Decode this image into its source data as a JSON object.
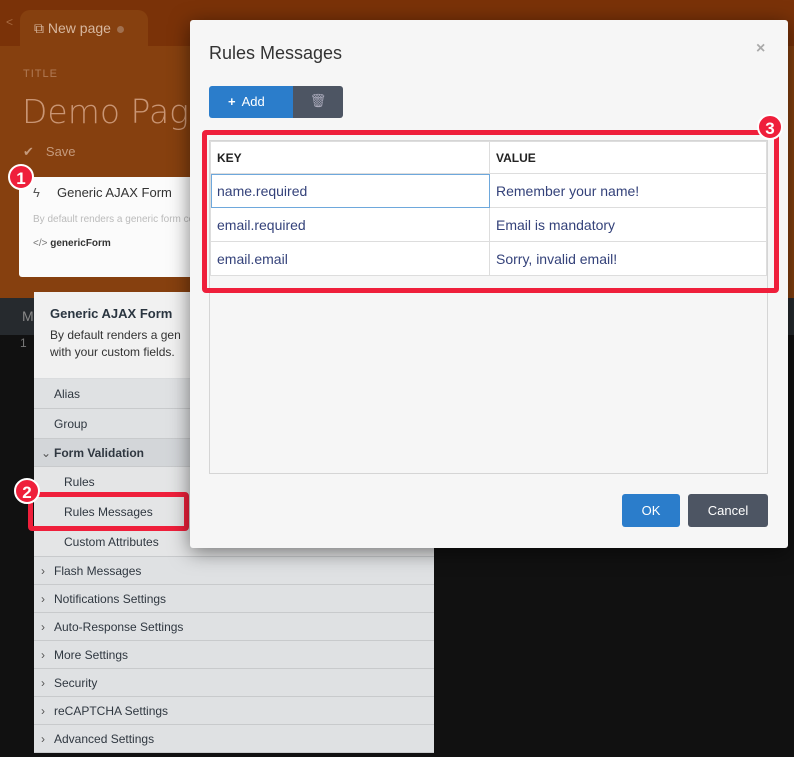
{
  "editor": {
    "tab_label": "New page",
    "title_label": "TITLE",
    "page_title": "Demo Page",
    "save_label": "Save",
    "code_tab": "M",
    "line_number": "1"
  },
  "component_card": {
    "title": "Generic AJAX Form",
    "description": "By default renders a generic form component HTML with your custom fields",
    "code": "genericForm"
  },
  "inspector": {
    "title": "Generic AJAX Form",
    "description_line1": "By default renders a gen",
    "description_line2": "with your custom fields.",
    "items": [
      {
        "label": "Alias"
      },
      {
        "label": "Group"
      },
      {
        "label": "Form Validation"
      },
      {
        "label": "Rules"
      },
      {
        "label": "Rules Messages"
      },
      {
        "label": "Custom Attributes"
      },
      {
        "label": "Flash Messages"
      },
      {
        "label": "Notifications Settings"
      },
      {
        "label": "Auto-Response Settings"
      },
      {
        "label": "More Settings"
      },
      {
        "label": "Security"
      },
      {
        "label": "reCAPTCHA Settings"
      },
      {
        "label": "Advanced Settings"
      }
    ]
  },
  "modal": {
    "title": "Rules Messages",
    "close": "×",
    "add_label": "Add",
    "columns": [
      "KEY",
      "VALUE"
    ],
    "rows": [
      {
        "key": "name.required",
        "value": "Remember your name!"
      },
      {
        "key": "email.required",
        "value": "Email is mandatory"
      },
      {
        "key": "email.email",
        "value": "Sorry, invalid email!"
      }
    ],
    "ok_label": "OK",
    "cancel_label": "Cancel"
  },
  "annotations": {
    "one": "1",
    "two": "2",
    "three": "3"
  },
  "colors": {
    "primary": "#2b7dcb",
    "secondary": "#4d5563",
    "highlight": "#ef1f3b"
  }
}
